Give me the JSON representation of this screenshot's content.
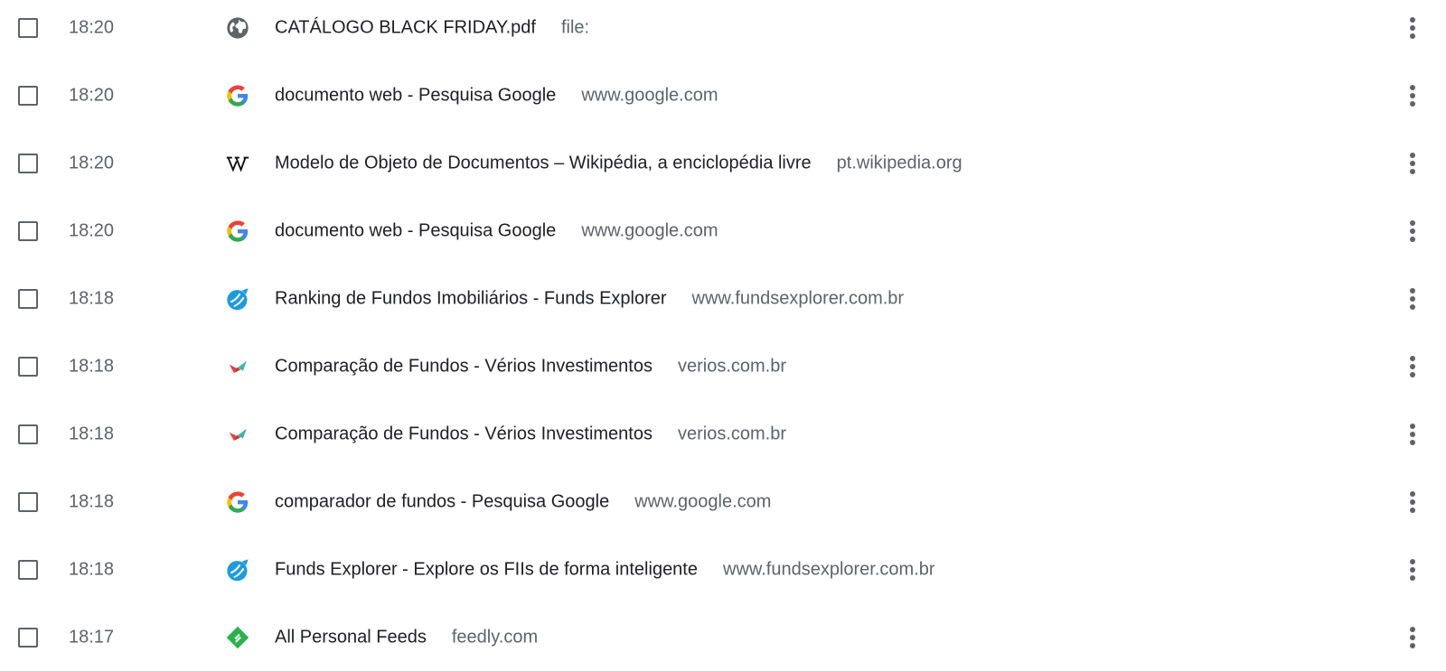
{
  "history": {
    "items": [
      {
        "time": "18:20",
        "title": "CATÁLOGO BLACK FRIDAY.pdf",
        "domain": "file:",
        "icon": "globe-icon"
      },
      {
        "time": "18:20",
        "title": "documento web - Pesquisa Google",
        "domain": "www.google.com",
        "icon": "google-icon"
      },
      {
        "time": "18:20",
        "title": "Modelo de Objeto de Documentos – Wikipédia, a enciclopédia livre",
        "domain": "pt.wikipedia.org",
        "icon": "wikipedia-icon"
      },
      {
        "time": "18:20",
        "title": "documento web - Pesquisa Google",
        "domain": "www.google.com",
        "icon": "google-icon"
      },
      {
        "time": "18:18",
        "title": "Ranking de Fundos Imobiliários - Funds Explorer",
        "domain": "www.fundsexplorer.com.br",
        "icon": "funds-explorer-icon"
      },
      {
        "time": "18:18",
        "title": "Comparação de Fundos - Vérios Investimentos",
        "domain": "verios.com.br",
        "icon": "verios-icon"
      },
      {
        "time": "18:18",
        "title": "Comparação de Fundos - Vérios Investimentos",
        "domain": "verios.com.br",
        "icon": "verios-icon"
      },
      {
        "time": "18:18",
        "title": "comparador de fundos - Pesquisa Google",
        "domain": "www.google.com",
        "icon": "google-icon"
      },
      {
        "time": "18:18",
        "title": "Funds Explorer - Explore os FIIs de forma inteligente",
        "domain": "www.fundsexplorer.com.br",
        "icon": "funds-explorer-icon"
      },
      {
        "time": "18:17",
        "title": "All Personal Feeds",
        "domain": "feedly.com",
        "icon": "feedly-icon"
      }
    ]
  },
  "colors": {
    "text": "#202124",
    "secondary_text": "#5f6368",
    "checkbox_border": "#5f6368"
  }
}
